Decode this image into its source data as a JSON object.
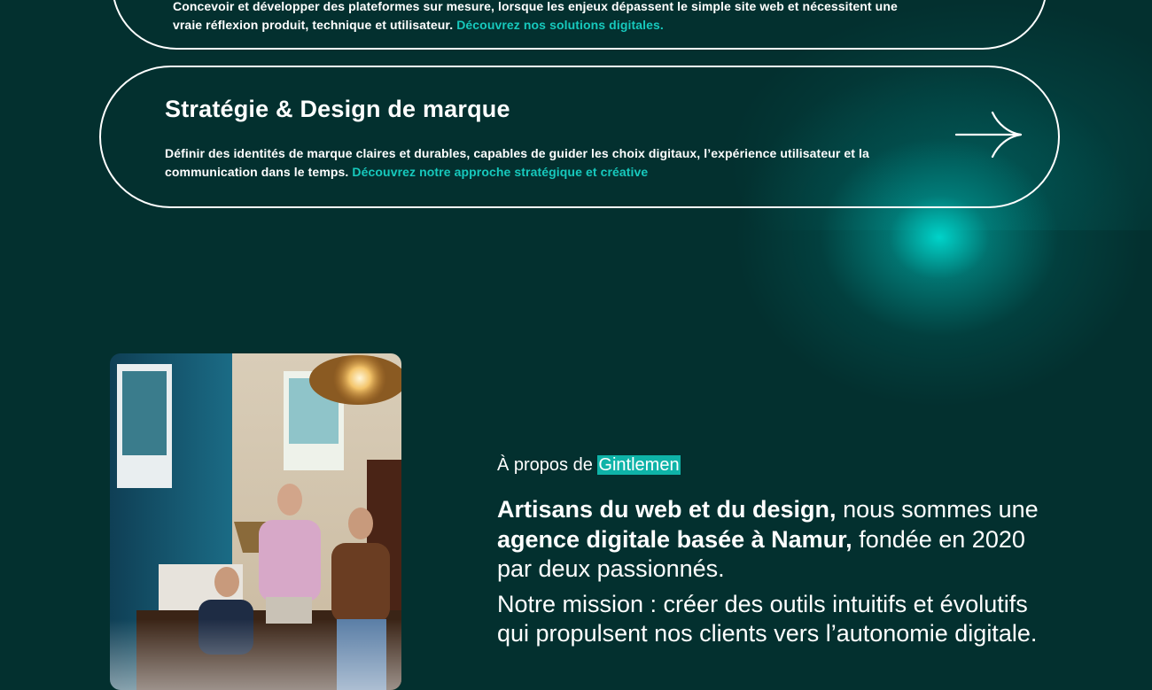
{
  "colors": {
    "background": "#03302f",
    "accent": "#17c9bd",
    "highlight": "#0fb3a8",
    "text": "#ffffff"
  },
  "cards": {
    "prev": {
      "desc_line1": "Concevoir et développer des plateformes sur mesure, lorsque les enjeux dépassent le simple site web et nécessitent une",
      "desc_line2": "vraie réflexion produit, technique et utilisateur.",
      "link": "Découvrez nos solutions digitales."
    },
    "branding": {
      "title": "Stratégie & Design de marque",
      "desc_line1": "Définir des identités de marque claires et durables, capables de guider les choix digitaux, l’expérience utilisateur et la",
      "desc_line2": "communication dans le temps.",
      "link": "Découvrez notre approche stratégique et créative",
      "arrow_icon": "arrow-right-icon"
    }
  },
  "about": {
    "eyebrow_prefix": "À propos de",
    "eyebrow_brand": "Gintlemen",
    "p1_bold1": "Artisans du web et du design,",
    "p1_text1": " nous sommes une ",
    "p1_bold2": "agence digitale basée à Namur,",
    "p1_text2": " fondée en 2020 par deux passionnés.",
    "p2": "Notre mission : créer des outils intuitifs et évolutifs qui propulsent nos clients vers l’autonomie digitale.",
    "photo_icon": "team-photo"
  }
}
